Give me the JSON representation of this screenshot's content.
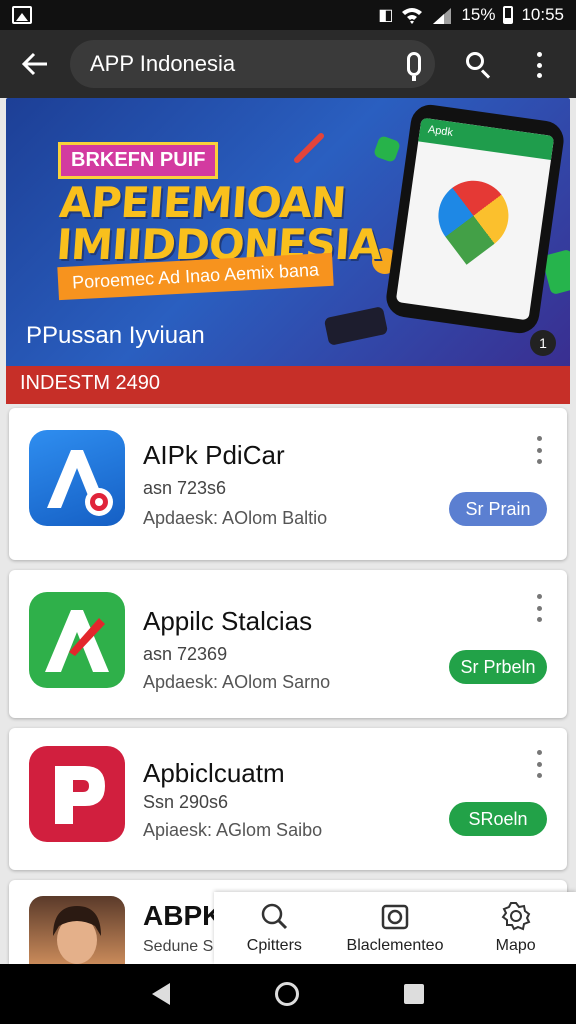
{
  "status_bar": {
    "battery": "15%",
    "time": "10:55"
  },
  "app_bar": {
    "search_value": "APP Indonesia"
  },
  "banner": {
    "tag": "BRKEFN PUIF",
    "headline_line1": "APEIEMIOAN",
    "headline_line2": "IMIIDDONESIA",
    "ribbon": "Poroemec Ad Inao Aemix bana",
    "caption": "PPussan Iyviuan",
    "phone_header": "Apdk",
    "page_indicator": "1"
  },
  "date_strip": "INDESTM 2490",
  "apps": [
    {
      "name": "AIPk PdiCar",
      "meta1": "asn 723s6",
      "meta2": "Apdaesk: AOlom Baltio",
      "action": "Sr Prain",
      "action_color": "#5b7fd1",
      "icon_bg": "#1e6fd6"
    },
    {
      "name": "Appilc Stalcias",
      "meta1": "asn 72369",
      "meta2": "Apdaesk: AOlom Sarno",
      "action": "Sr Prbeln",
      "action_color": "#22a248",
      "icon_bg": "#2fb04a"
    },
    {
      "name": "Apbiclcuatm",
      "meta1": "Ssn 290s6",
      "meta2": "Apiaesk: AGlom Saibo",
      "action": "SRoeln",
      "action_color": "#22a248",
      "icon_bg": "#d11f3e"
    },
    {
      "name": "ABPK",
      "meta1": "Sedune Sa"
    }
  ],
  "bottom_tray": [
    {
      "label": "Cpitters",
      "icon": "search-icon"
    },
    {
      "label": "Blaclementeo",
      "icon": "camera-icon"
    },
    {
      "label": "Mapo",
      "icon": "gear-icon"
    }
  ]
}
